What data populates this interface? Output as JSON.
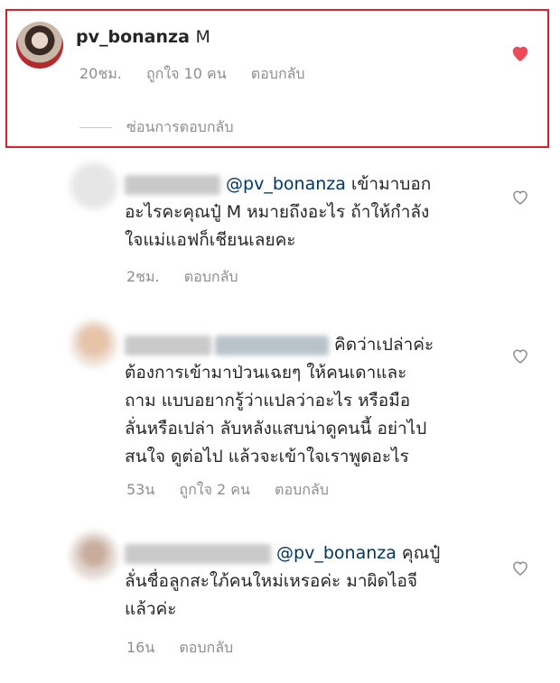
{
  "main_comment": {
    "username": "pv_bonanza",
    "text": "M",
    "time": "20ชม.",
    "likes": "ถูกใจ 10 คน",
    "reply": "ตอบกลับ",
    "hide_replies": "ซ่อนการตอบกลับ",
    "liked": true
  },
  "replies": [
    {
      "mention": "@pv_bonanza",
      "line1_rest": " เข้ามาบอก",
      "line2": "อะไรคะคุณปู๋ M หมายถึงอะไร ถ้าให้กำลัง",
      "line3": "ใจแม่แอฟก็เชียนเลยคะ",
      "time": "2ชม.",
      "reply": "ตอบกลับ"
    },
    {
      "line1": "คิดว่าเปล่าค่ะ",
      "line2": "ต้องการเข้ามาป่วนเฉยๆ ให้คนเดาและ",
      "line3": "ถาม  แบบอยากรู้ว่าแปลว่าอะไร หรือมือ",
      "line4": "ลั่นหรือเปล่า ลับหลังแสบน่าดูคนนี้ อย่าไป",
      "line5": "สนใจ ดูต่อไป แล้วจะเข้าใจเราพูดอะไร",
      "time": "53น",
      "likes": "ถูกใจ 2 คน",
      "reply": "ตอบกลับ"
    },
    {
      "mention": "@pv_bonanza",
      "line1_rest": " คุณปู๋",
      "line2": "ลั่นชื่อลูกสะใภ้คนใหม่เหรอค่ะ มาผิดไอจี",
      "line3": "แล้วค่ะ",
      "time": "16น",
      "reply": "ตอบกลับ"
    }
  ],
  "colors": {
    "highlight": "#e11d2b",
    "heart_filled": "#ed4956",
    "mention": "#003569",
    "meta": "#8e8e8e"
  }
}
